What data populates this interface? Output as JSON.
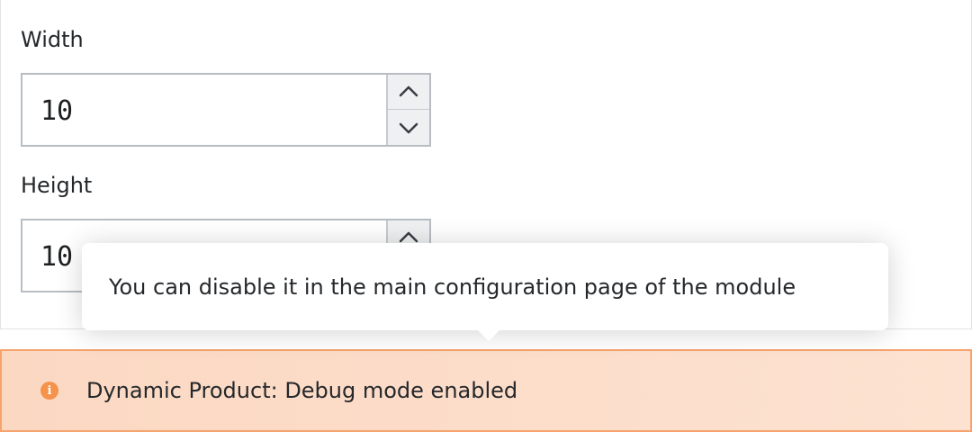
{
  "form": {
    "width": {
      "label": "Width",
      "value": "10"
    },
    "height": {
      "label": "Height",
      "value": "10"
    }
  },
  "tooltip": {
    "text": "You can disable it in the main configuration page of the module"
  },
  "alert": {
    "icon": "info-icon",
    "text": "Dynamic Product: Debug mode enabled",
    "colors": {
      "background": "#fbd8c2",
      "border": "#f6a36d",
      "icon": "#f5924c"
    }
  }
}
